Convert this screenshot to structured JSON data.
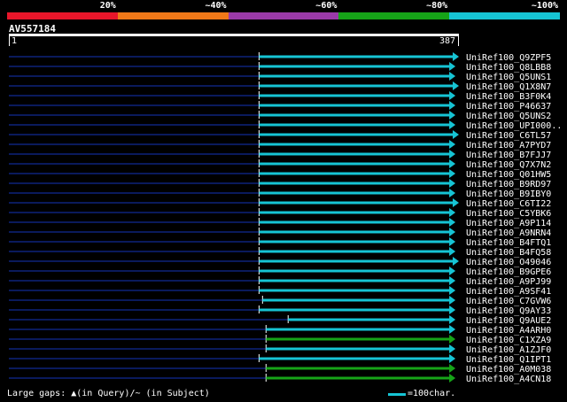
{
  "identity_scale": [
    {
      "label": "20%",
      "color": "#e8162a"
    },
    {
      "label": "~40%",
      "color": "#f07818"
    },
    {
      "label": "~60%",
      "color": "#9a3aa8"
    },
    {
      "label": "~80%",
      "color": "#16a418"
    },
    {
      "label": "~100%",
      "color": "#16c4d4"
    }
  ],
  "query": {
    "name": "AV557184",
    "start": "1",
    "end": "387",
    "length": 387
  },
  "colors": {
    "background": "#000000",
    "gap_line": "#0a1a5c",
    "cyan": "#16c4d4",
    "green": "#16a418"
  },
  "hits": [
    {
      "name": "UniRef100_Q9ZPF5",
      "start": 216,
      "end": 387,
      "color": "#16c4d4",
      "arrow": true
    },
    {
      "name": "UniRef100_Q8LBB8",
      "start": 216,
      "end": 384,
      "color": "#16c4d4",
      "arrow": true
    },
    {
      "name": "UniRef100_Q5UNS1",
      "start": 216,
      "end": 384,
      "color": "#16c4d4",
      "arrow": true
    },
    {
      "name": "UniRef100_Q1X8N7",
      "start": 216,
      "end": 387,
      "color": "#16c4d4",
      "arrow": true
    },
    {
      "name": "UniRef100_B3F0K4",
      "start": 216,
      "end": 384,
      "color": "#16c4d4",
      "arrow": true
    },
    {
      "name": "UniRef100_P46637",
      "start": 216,
      "end": 384,
      "color": "#16c4d4",
      "arrow": true
    },
    {
      "name": "UniRef100_Q5UNS2",
      "start": 216,
      "end": 384,
      "color": "#16c4d4",
      "arrow": true
    },
    {
      "name": "UniRef100_UPI000..",
      "start": 216,
      "end": 384,
      "color": "#16c4d4",
      "arrow": true
    },
    {
      "name": "UniRef100_C6TL57",
      "start": 216,
      "end": 387,
      "color": "#16c4d4",
      "arrow": true
    },
    {
      "name": "UniRef100_A7PYD7",
      "start": 216,
      "end": 384,
      "color": "#16c4d4",
      "arrow": true
    },
    {
      "name": "UniRef100_B7FJJ7",
      "start": 216,
      "end": 384,
      "color": "#16c4d4",
      "arrow": true
    },
    {
      "name": "UniRef100_Q7X7N2",
      "start": 216,
      "end": 384,
      "color": "#16c4d4",
      "arrow": true
    },
    {
      "name": "UniRef100_Q01HW5",
      "start": 216,
      "end": 384,
      "color": "#16c4d4",
      "arrow": true
    },
    {
      "name": "UniRef100_B9RD97",
      "start": 216,
      "end": 384,
      "color": "#16c4d4",
      "arrow": true
    },
    {
      "name": "UniRef100_B9IBY0",
      "start": 216,
      "end": 384,
      "color": "#16c4d4",
      "arrow": true
    },
    {
      "name": "UniRef100_C6TI22",
      "start": 216,
      "end": 387,
      "color": "#16c4d4",
      "arrow": true
    },
    {
      "name": "UniRef100_C5YBK6",
      "start": 216,
      "end": 384,
      "color": "#16c4d4",
      "arrow": true
    },
    {
      "name": "UniRef100_A9P114",
      "start": 216,
      "end": 384,
      "color": "#16c4d4",
      "arrow": true
    },
    {
      "name": "UniRef100_A9NRN4",
      "start": 216,
      "end": 384,
      "color": "#16c4d4",
      "arrow": true
    },
    {
      "name": "UniRef100_B4FTQ1",
      "start": 216,
      "end": 384,
      "color": "#16c4d4",
      "arrow": true
    },
    {
      "name": "UniRef100_B4FQ58",
      "start": 216,
      "end": 384,
      "color": "#16c4d4",
      "arrow": true
    },
    {
      "name": "UniRef100_O49046",
      "start": 216,
      "end": 387,
      "color": "#16c4d4",
      "arrow": true
    },
    {
      "name": "UniRef100_B9GPE6",
      "start": 216,
      "end": 384,
      "color": "#16c4d4",
      "arrow": true
    },
    {
      "name": "UniRef100_A9PJ99",
      "start": 216,
      "end": 384,
      "color": "#16c4d4",
      "arrow": true
    },
    {
      "name": "UniRef100_A9SF41",
      "start": 216,
      "end": 384,
      "color": "#16c4d4",
      "arrow": true
    },
    {
      "name": "UniRef100_C7GVW6",
      "start": 219,
      "end": 384,
      "color": "#16c4d4",
      "arrow": true
    },
    {
      "name": "UniRef100_Q9AY33",
      "start": 216,
      "end": 384,
      "color": "#16c4d4",
      "arrow": true
    },
    {
      "name": "UniRef100_Q9AUE2",
      "start": 241,
      "end": 384,
      "color": "#16c4d4",
      "arrow": true
    },
    {
      "name": "UniRef100_A4ARH0",
      "start": 222,
      "end": 384,
      "color": "#16c4d4",
      "arrow": true
    },
    {
      "name": "UniRef100_C1XZA9",
      "start": 222,
      "end": 384,
      "color": "#16a418",
      "arrow": true
    },
    {
      "name": "UniRef100_A1ZJF0",
      "start": 222,
      "end": 384,
      "color": "#16c4d4",
      "arrow": true
    },
    {
      "name": "UniRef100_Q1IPT1",
      "start": 216,
      "end": 384,
      "color": "#16c4d4",
      "arrow": true
    },
    {
      "name": "UniRef100_A0M038",
      "start": 222,
      "end": 384,
      "color": "#16a418",
      "arrow": true
    },
    {
      "name": "UniRef100_A4CN18",
      "start": 222,
      "end": 384,
      "color": "#16a418",
      "arrow": true
    }
  ],
  "footer": {
    "large_gaps_text": "Large gaps: ▲(in Query)/~ (in Subject)",
    "legend_text": "=100char."
  }
}
